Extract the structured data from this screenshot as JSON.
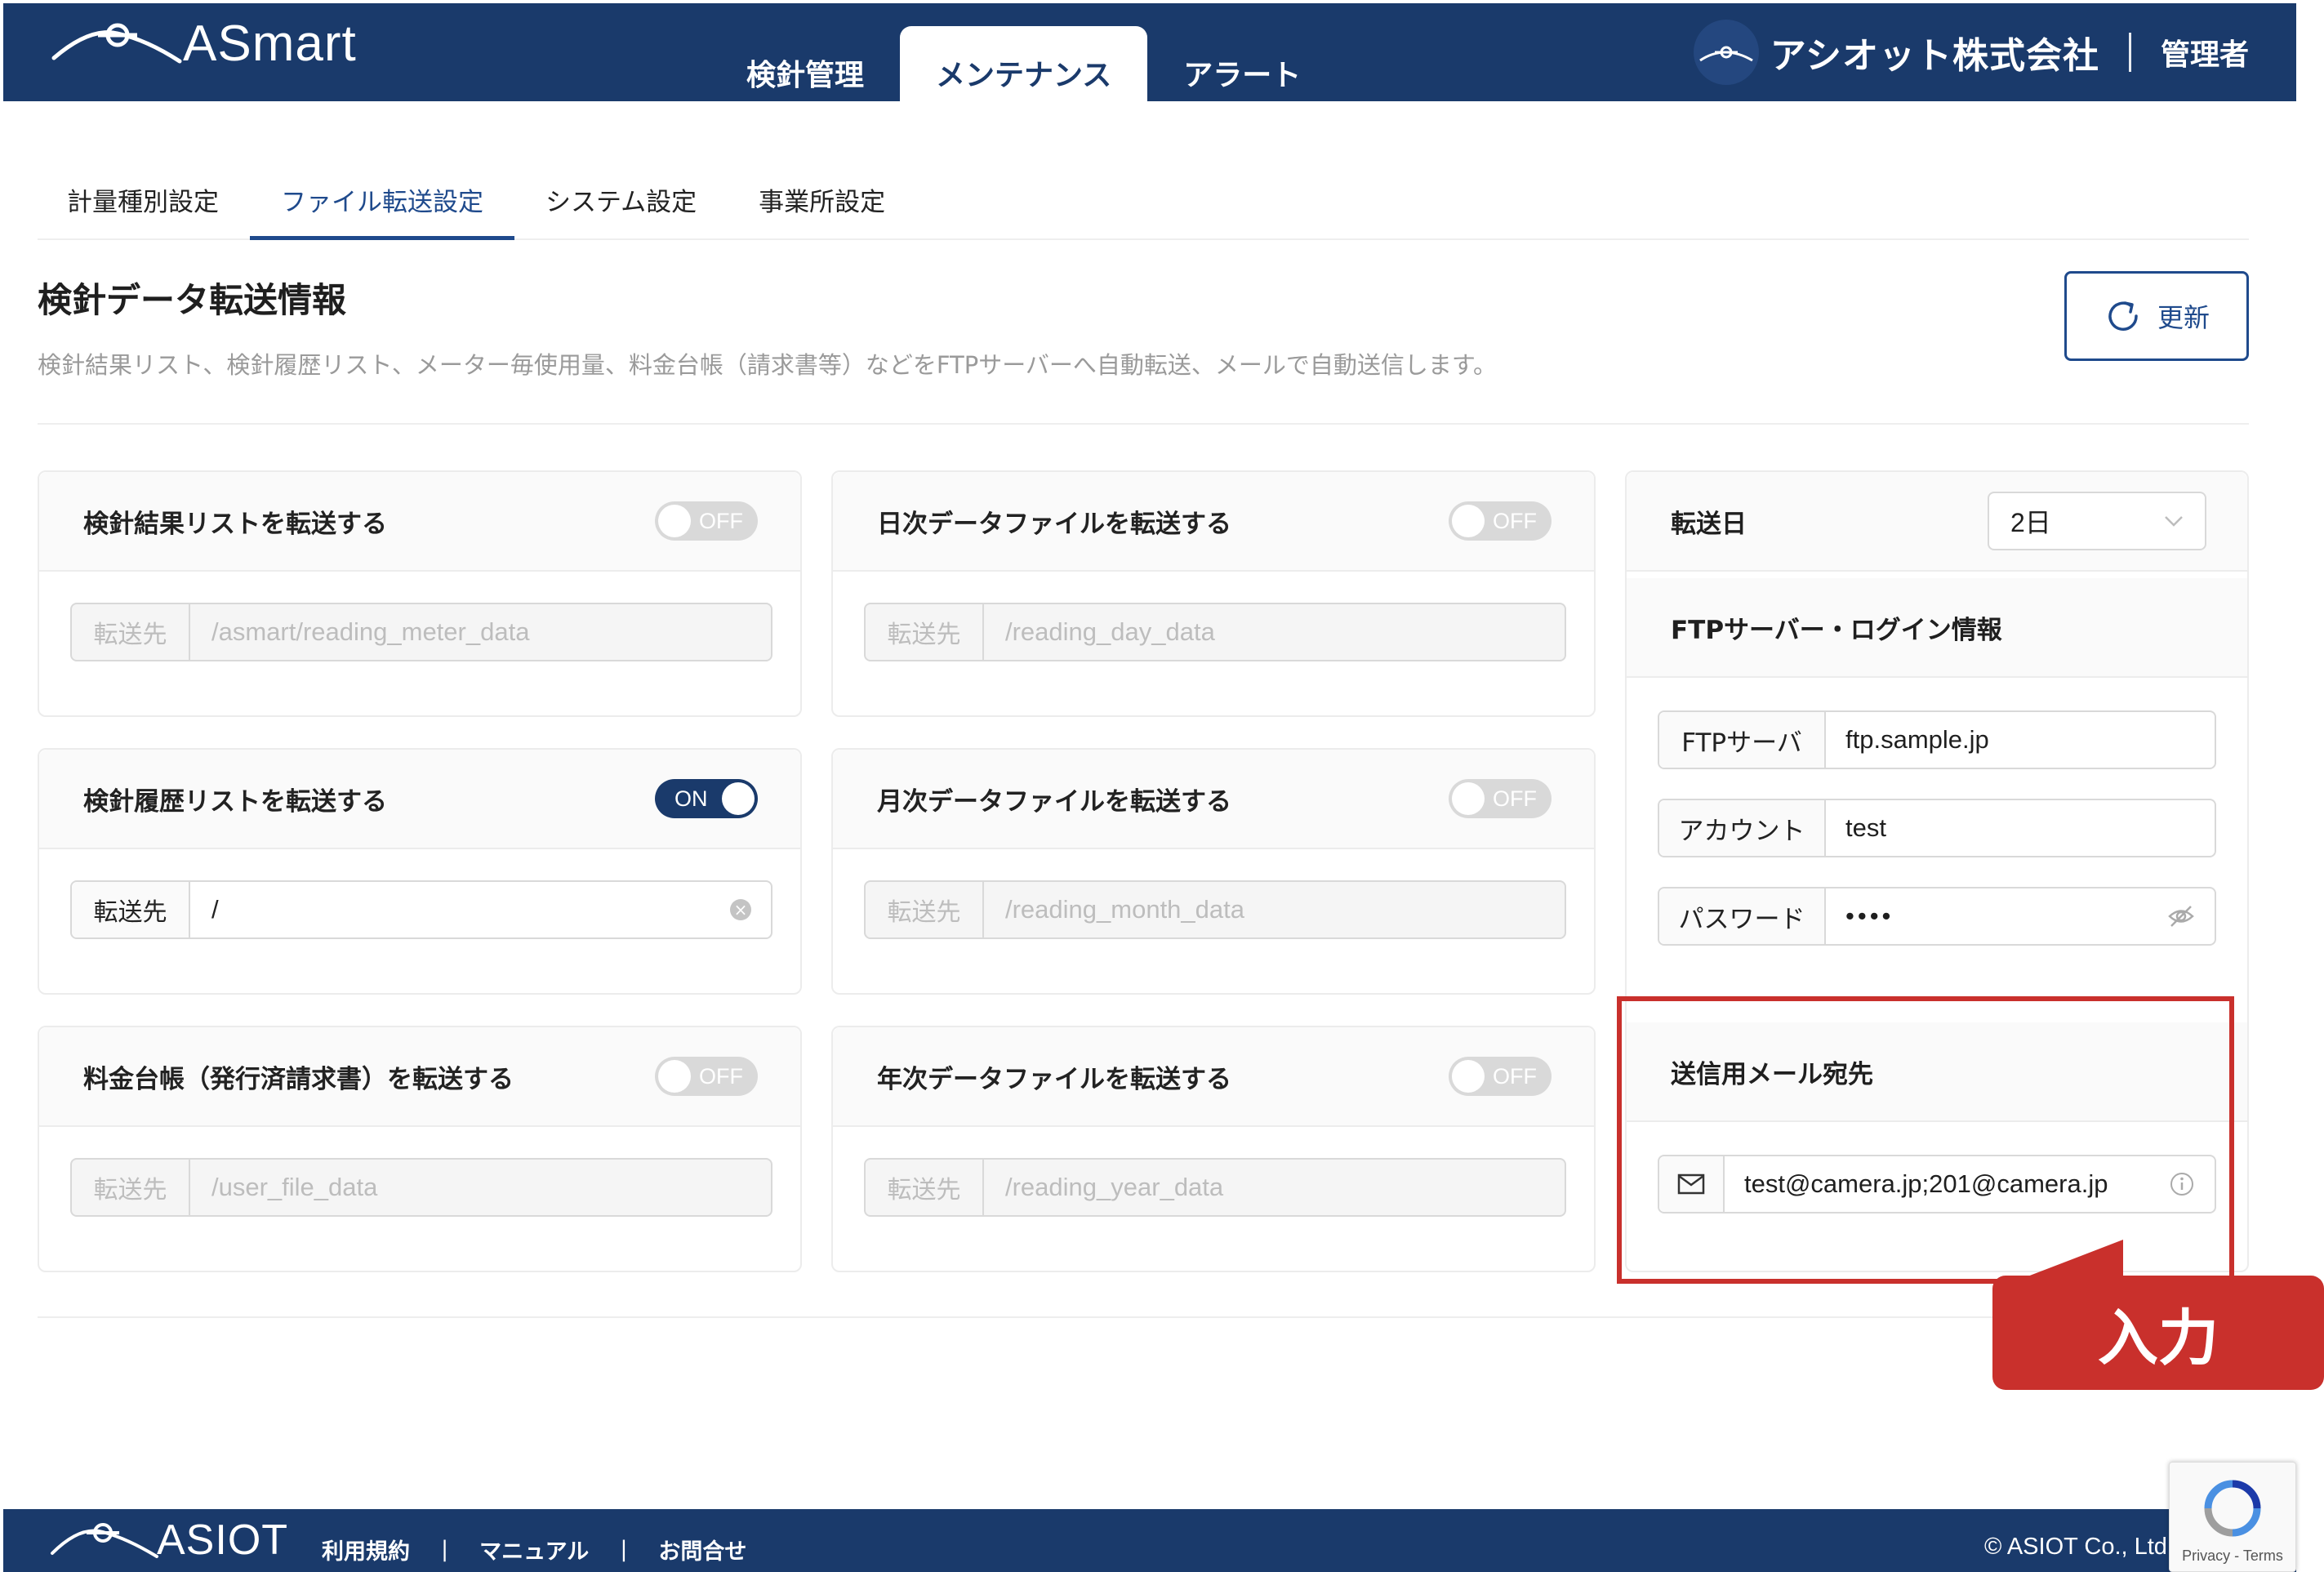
{
  "header": {
    "logo_text": "ASmart",
    "nav": [
      {
        "label": "検針管理"
      },
      {
        "label": "メンテナンス"
      },
      {
        "label": "アラート"
      }
    ],
    "company_name": "アシオット株式会社",
    "user_role": "管理者"
  },
  "subtabs": [
    {
      "label": "計量種別設定"
    },
    {
      "label": "ファイル転送設定"
    },
    {
      "label": "システム設定"
    },
    {
      "label": "事業所設定"
    }
  ],
  "page": {
    "title": "検針データ転送情報",
    "description": "検針結果リスト、検針履歴リスト、メーター毎使用量、料金台帳（請求書等）などをFTPサーバーへ自動転送、メールで自動送信します。",
    "refresh_label": "更新"
  },
  "cards": [
    {
      "title": "検針結果リストを転送する",
      "toggle": "OFF",
      "addon": "転送先",
      "value": "/asmart/reading_meter_data"
    },
    {
      "title": "日次データファイルを転送する",
      "toggle": "OFF",
      "addon": "転送先",
      "value": "/reading_day_data"
    },
    {
      "title": "検針履歴リストを転送する",
      "toggle": "ON",
      "addon": "転送先",
      "value": "/"
    },
    {
      "title": "月次データファイルを転送する",
      "toggle": "OFF",
      "addon": "転送先",
      "value": "/reading_month_data"
    },
    {
      "title": "料金台帳（発行済請求書）を転送する",
      "toggle": "OFF",
      "addon": "転送先",
      "value": "/user_file_data"
    },
    {
      "title": "年次データファイルを転送する",
      "toggle": "OFF",
      "addon": "転送先",
      "value": "/reading_year_data"
    }
  ],
  "transfer_day": {
    "label": "転送日",
    "value": "2日"
  },
  "ftp": {
    "title": "FTPサーバー・ログイン情報",
    "server_label": "FTPサーバ",
    "server_value": "ftp.sample.jp",
    "account_label": "アカウント",
    "account_value": "test",
    "password_label": "パスワード",
    "password_value": "••••"
  },
  "mail": {
    "title": "送信用メール宛先",
    "value": "test@camera.jp;201@camera.jp"
  },
  "callout": {
    "label": "入力",
    "color": "#c9302c"
  },
  "footer": {
    "logo_text": "ASIOT",
    "links": [
      {
        "label": "利用規約"
      },
      {
        "label": "マニュアル"
      },
      {
        "label": "お問合せ"
      }
    ],
    "separator": "|",
    "copyright": "© ASIOT Co., Ltd."
  },
  "recaptcha": {
    "label": "Privacy - Terms"
  },
  "colors": {
    "primary": "#1a3a6b",
    "accent": "#1f4a8c",
    "highlight": "#c9302c"
  }
}
